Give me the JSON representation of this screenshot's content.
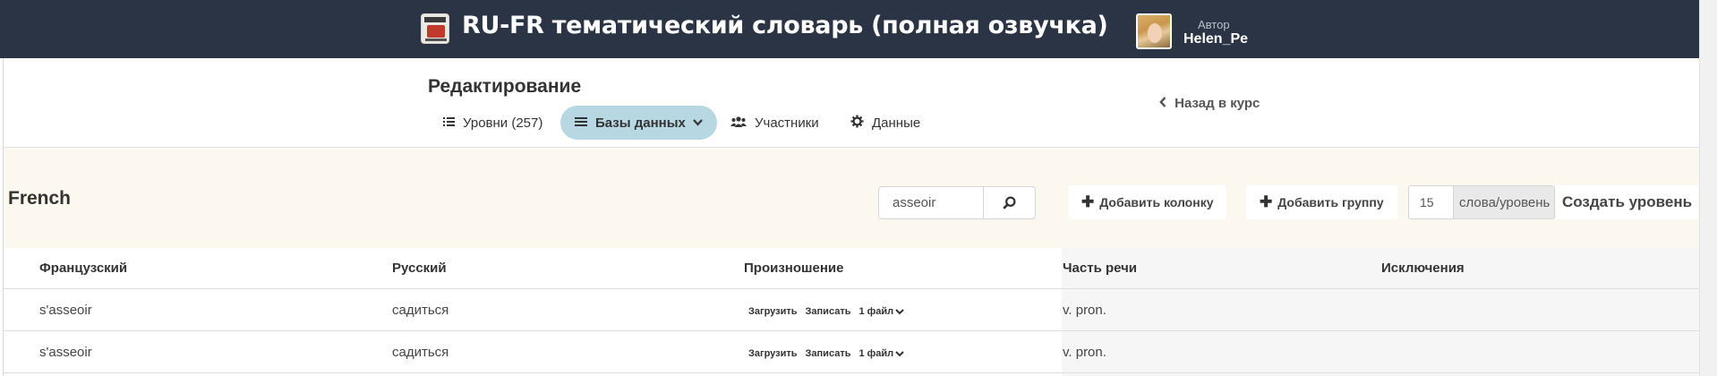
{
  "header": {
    "course_title": "RU-FR тематический словарь (полная озвучка)",
    "author_label": "Автор",
    "author_name": "Helen_Pe"
  },
  "edit_nav": {
    "title": "Редактирование",
    "tabs": [
      {
        "label": "Уровни (257)",
        "icon": "list-icon",
        "active": false
      },
      {
        "label": "Базы данных",
        "icon": "menu-icon",
        "active": true
      },
      {
        "label": "Участники",
        "icon": "users-icon",
        "active": false
      },
      {
        "label": "Данные",
        "icon": "gear-icon",
        "active": false
      }
    ],
    "back_link": "Назад в курс"
  },
  "database": {
    "name": "French",
    "search_value": "asseoir",
    "add_column_label": "Добавить колонку",
    "add_group_label": "Добавить группу",
    "words_per_level_value": "15",
    "words_per_level_unit": "слова/уровень",
    "create_level_label": "Создать уровень"
  },
  "table": {
    "columns": [
      "Французский",
      "Русский",
      "Произношение",
      "Часть речи",
      "Исключения"
    ],
    "upload_label": "Загрузить",
    "record_label": "Записать",
    "rows": [
      {
        "french": "s'asseoir",
        "russian": "садиться",
        "files": "1 файл",
        "part_of_speech": "v. pron.",
        "exceptions": ""
      },
      {
        "french": "s'asseoir",
        "russian": "садиться",
        "files": "1 файл",
        "part_of_speech": "v. pron.",
        "exceptions": ""
      }
    ]
  },
  "colors": {
    "header_bg": "#2b3444",
    "active_tab_bg": "#b7d7e2",
    "toolbar_bg": "#fcf8ef"
  }
}
